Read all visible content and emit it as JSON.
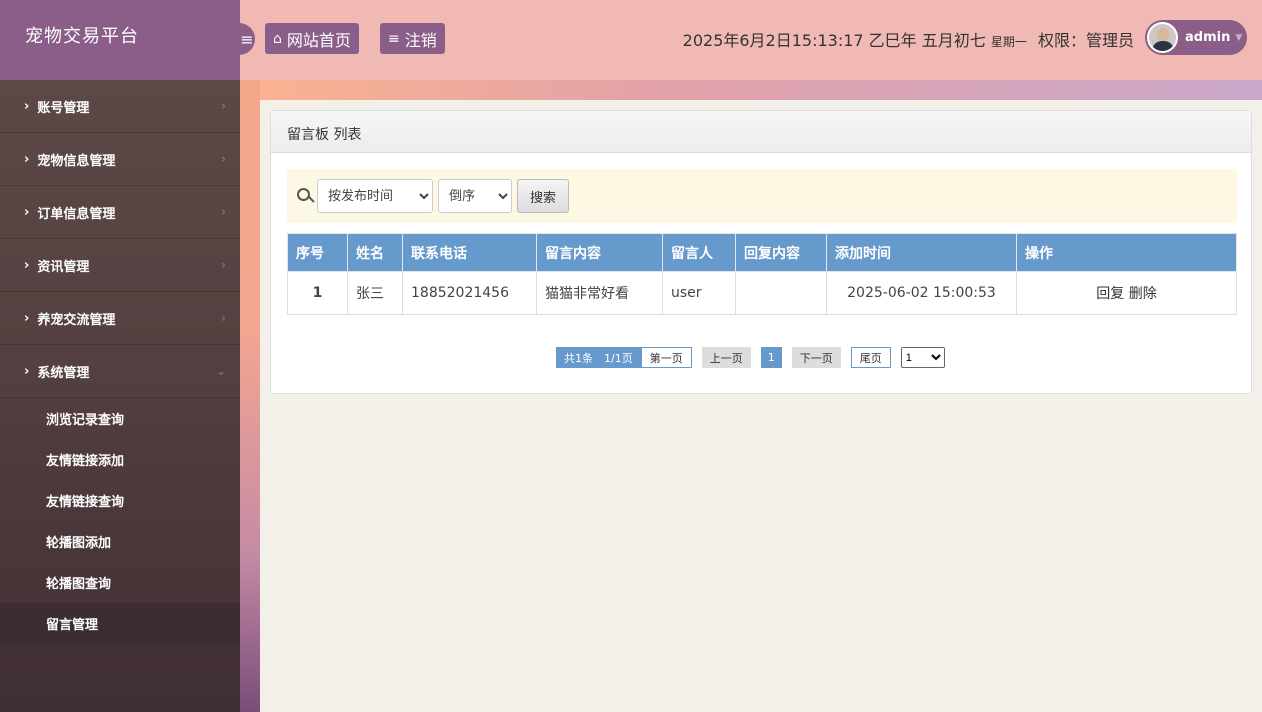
{
  "sidebar": {
    "brand": "宠物交易平台",
    "menus": [
      {
        "label": "账号管理"
      },
      {
        "label": "宠物信息管理"
      },
      {
        "label": "订单信息管理"
      },
      {
        "label": "资讯管理"
      },
      {
        "label": "养宠交流管理"
      },
      {
        "label": "系统管理"
      }
    ],
    "sub_items": [
      {
        "label": "浏览记录查询"
      },
      {
        "label": "友情链接添加"
      },
      {
        "label": "友情链接查询"
      },
      {
        "label": "轮播图添加"
      },
      {
        "label": "轮播图查询"
      },
      {
        "label": "留言管理"
      }
    ]
  },
  "header": {
    "home_label": "网站首页",
    "logout_label": "注销",
    "datetime": "2025年6月2日15:13:17 乙巳年 五月初七",
    "weekday": "星期一",
    "role": "权限：管理员",
    "username": "admin"
  },
  "panel": {
    "title": "留言板 列表",
    "sort_field": "按发布时间",
    "sort_order": "倒序",
    "search_label": "搜索"
  },
  "table": {
    "headers": [
      "序号",
      "姓名",
      "联系电话",
      "留言内容",
      "留言人",
      "回复内容",
      "添加时间",
      "操作"
    ],
    "rows": [
      {
        "no": "1",
        "name": "张三",
        "phone": "18852021456",
        "content": "猫猫非常好看",
        "user": "user",
        "reply": "",
        "time": "2025-06-02 15:00:53",
        "reply_action": "回复",
        "delete_action": "删除"
      }
    ]
  },
  "pager": {
    "info": "共1条　1/1页",
    "first": "第一页",
    "prev": "上一页",
    "current": "1",
    "next": "下一页",
    "last": "尾页",
    "select": "1"
  }
}
